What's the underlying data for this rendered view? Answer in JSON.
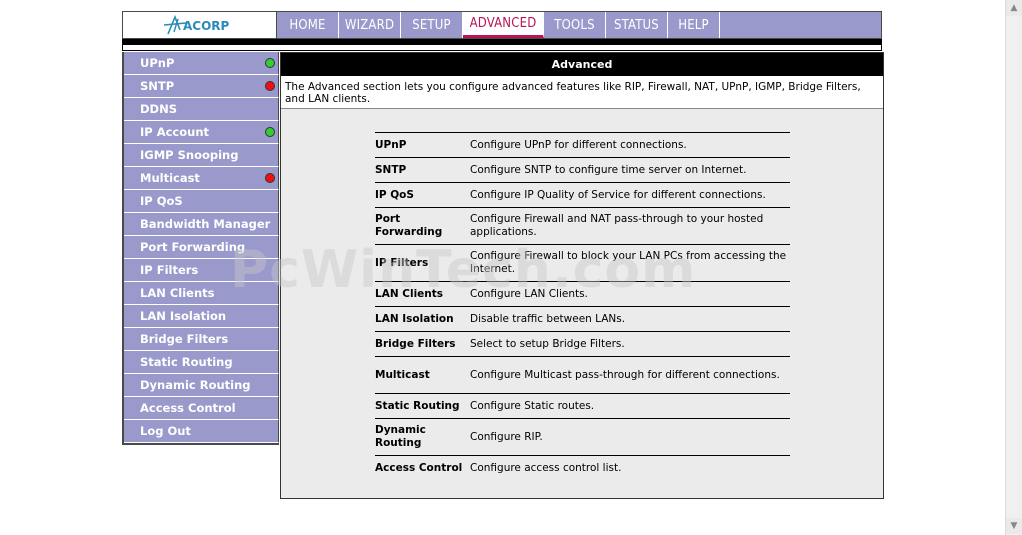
{
  "header": {
    "logo_text": "ACORP",
    "tabs": [
      {
        "label": "HOME",
        "active": false
      },
      {
        "label": "WIZARD",
        "active": false
      },
      {
        "label": "SETUP",
        "active": false
      },
      {
        "label": "ADVANCED",
        "active": true
      },
      {
        "label": "TOOLS",
        "active": false
      },
      {
        "label": "STATUS",
        "active": false
      },
      {
        "label": "HELP",
        "active": false
      }
    ]
  },
  "sidebar": {
    "items": [
      {
        "label": "UPnP",
        "status": "green"
      },
      {
        "label": "SNTP",
        "status": "red"
      },
      {
        "label": "DDNS",
        "status": ""
      },
      {
        "label": "IP Account",
        "status": "green"
      },
      {
        "label": "IGMP Snooping",
        "status": ""
      },
      {
        "label": "Multicast",
        "status": "red"
      },
      {
        "label": "IP QoS",
        "status": ""
      },
      {
        "label": "Bandwidth Manager",
        "status": ""
      },
      {
        "label": "Port Forwarding",
        "status": ""
      },
      {
        "label": "IP Filters",
        "status": ""
      },
      {
        "label": "LAN Clients",
        "status": ""
      },
      {
        "label": "LAN Isolation",
        "status": ""
      },
      {
        "label": "Bridge Filters",
        "status": ""
      },
      {
        "label": "Static Routing",
        "status": ""
      },
      {
        "label": "Dynamic Routing",
        "status": ""
      },
      {
        "label": "Access Control",
        "status": ""
      },
      {
        "label": "Log Out",
        "status": ""
      }
    ]
  },
  "main": {
    "title": "Advanced",
    "intro": "The Advanced section lets you configure advanced features like RIP, Firewall, NAT, UPnP, IGMP, Bridge Filters, and LAN clients.",
    "features": [
      {
        "name": "UPnP",
        "desc": "Configure UPnP for different connections."
      },
      {
        "name": "SNTP",
        "desc": "Configure SNTP to configure time server on Internet."
      },
      {
        "name": "IP QoS",
        "desc": "Configure IP Quality of Service for different connections."
      },
      {
        "name": "Port Forwarding",
        "desc": "Configure Firewall and NAT pass-through to your hosted applications."
      },
      {
        "name": "IP Filters",
        "desc": "Configure Firewall to block your LAN PCs from accessing the Internet."
      },
      {
        "name": "LAN Clients",
        "desc": "Configure LAN Clients."
      },
      {
        "name": "LAN Isolation",
        "desc": "Disable traffic between LANs."
      },
      {
        "name": "Bridge Filters",
        "desc": "Select to setup Bridge Filters."
      },
      {
        "name": "Multicast",
        "desc": "Configure Multicast pass-through for different connections."
      },
      {
        "name": "Static Routing",
        "desc": "Configure Static routes."
      },
      {
        "name": "Dynamic Routing",
        "desc": "Configure RIP."
      },
      {
        "name": "Access Control",
        "desc": "Configure access control list."
      }
    ]
  },
  "watermark": "PcWinTech.com",
  "colors": {
    "nav_bg": "#9999cc",
    "active_tab": "#b8145a",
    "status_green": "#33cc33",
    "status_red": "#ee1111"
  }
}
